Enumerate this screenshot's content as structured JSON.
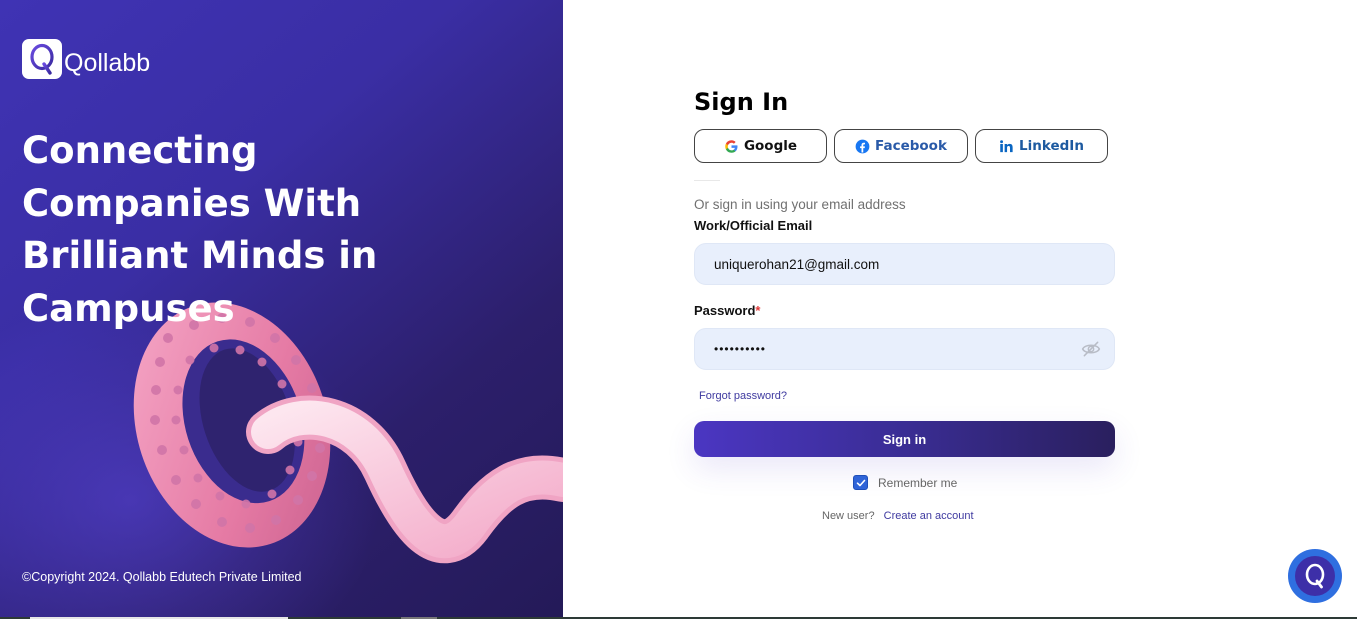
{
  "brand": {
    "name": "Qollabb"
  },
  "hero": {
    "headline": "Connecting Companies With Brilliant Minds in Campuses"
  },
  "footer": {
    "copyright": "©Copyright 2024. Qollabb Edutech Private Limited"
  },
  "signin": {
    "title": "Sign In",
    "social": {
      "google": "Google",
      "facebook": "Facebook",
      "linkedin": "LinkedIn"
    },
    "or_text": "Or sign in using your email address",
    "email_label": "Work/Official Email",
    "email_value": "uniquerohan21@gmail.com",
    "password_label": "Password",
    "password_required_mark": "*",
    "password_value": "••••••••••",
    "forgot": "Forgot password?",
    "submit": "Sign in",
    "remember_label": "Remember me",
    "remember_checked": true,
    "new_user_text": "New user?",
    "create_account": "Create an account"
  },
  "icons": {
    "google": "google-icon",
    "facebook": "facebook-icon",
    "linkedin": "linkedin-icon",
    "password_toggle": "eye-slash-icon",
    "chat": "chat-assistant-icon"
  },
  "colors": {
    "panel_start": "#3f33b4",
    "panel_end": "#241a58",
    "accent": "#3f3aa0",
    "field_bg": "#e8effc",
    "checkbox": "#2f64d8",
    "chat_bubble": "#2f6fe0",
    "required": "#e23a3a"
  }
}
